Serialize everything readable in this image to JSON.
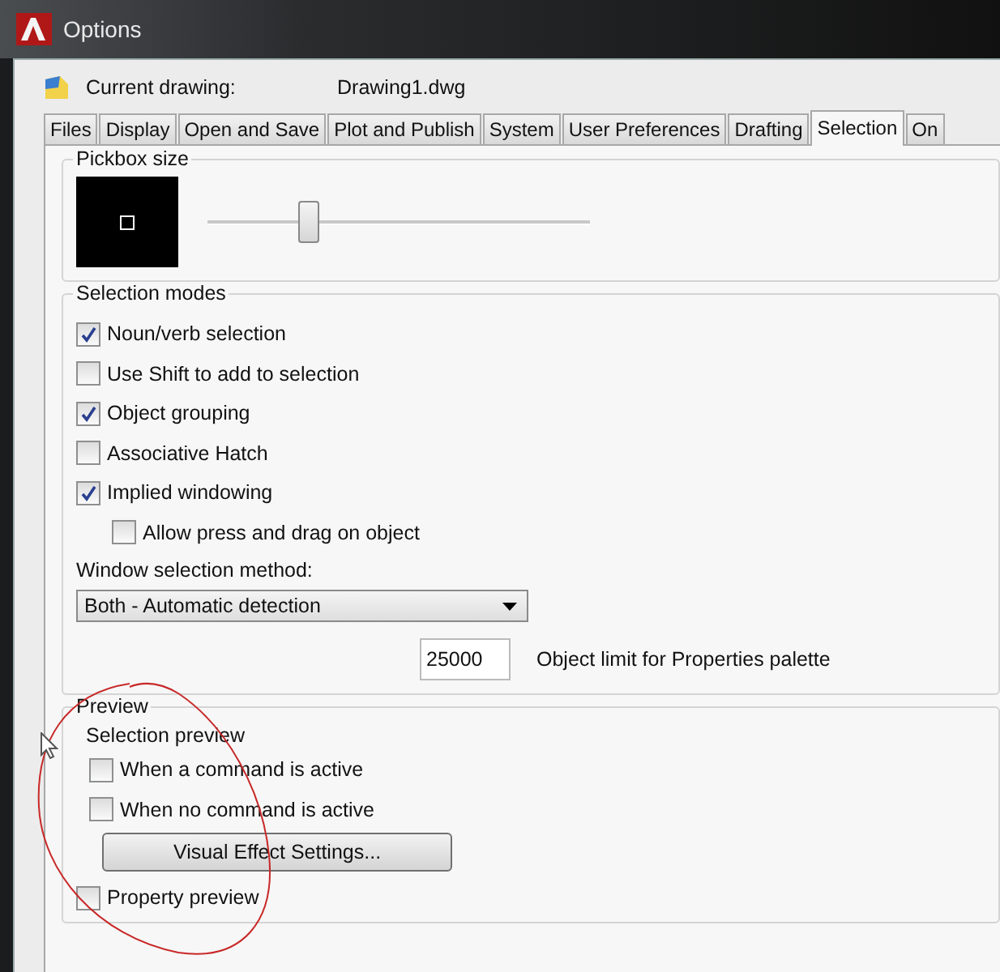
{
  "window": {
    "title": "Options"
  },
  "current_drawing": {
    "label": "Current drawing:",
    "value": "Drawing1.dwg"
  },
  "tabs": [
    {
      "label": "Files",
      "selected": false
    },
    {
      "label": "Display",
      "selected": false
    },
    {
      "label": "Open and Save",
      "selected": false
    },
    {
      "label": "Plot and Publish",
      "selected": false
    },
    {
      "label": "System",
      "selected": false
    },
    {
      "label": "User Preferences",
      "selected": false
    },
    {
      "label": "Drafting",
      "selected": false
    },
    {
      "label": "Selection",
      "selected": true
    },
    {
      "label": "On",
      "selected": false
    }
  ],
  "pickbox": {
    "title": "Pickbox size",
    "level": 0.26
  },
  "selection_modes": {
    "title": "Selection modes",
    "options": [
      {
        "label": "Noun/verb selection",
        "checked": true
      },
      {
        "label": "Use Shift to add to selection",
        "checked": false
      },
      {
        "label": "Object grouping",
        "checked": true
      },
      {
        "label": "Associative Hatch",
        "checked": false
      },
      {
        "label": "Implied windowing",
        "checked": true,
        "children": [
          {
            "label": "Allow press and drag on object",
            "checked": false
          }
        ]
      }
    ],
    "window_method": {
      "label": "Window selection method:",
      "value": "Both - Automatic detection"
    },
    "object_limit": {
      "value": "25000",
      "label": "Object limit for Properties palette"
    }
  },
  "preview": {
    "title": "Preview",
    "selection_preview": {
      "label": "Selection preview",
      "options": [
        {
          "label": "When a command is active",
          "checked": false
        },
        {
          "label": "When no command is active",
          "checked": false
        }
      ]
    },
    "button": "Visual Effect Settings...",
    "property_preview": {
      "label": "Property preview",
      "checked": false
    }
  }
}
